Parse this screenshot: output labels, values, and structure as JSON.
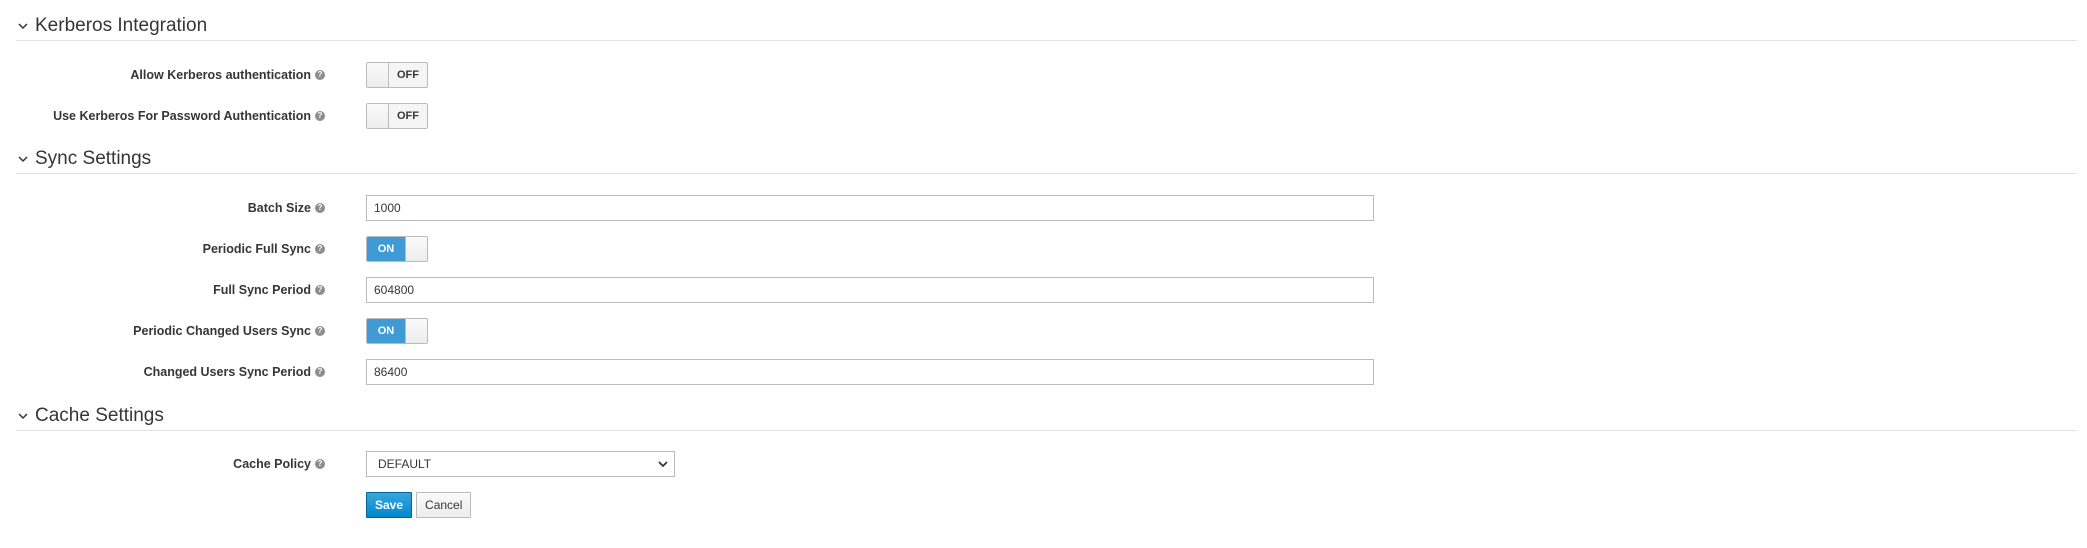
{
  "sections": {
    "kerberos": {
      "title": "Kerberos Integration",
      "fields": {
        "allow_kerberos_auth": {
          "label": "Allow Kerberos authentication",
          "state": "OFF"
        },
        "use_kerberos_password": {
          "label": "Use Kerberos For Password Authentication",
          "state": "OFF"
        }
      }
    },
    "sync": {
      "title": "Sync Settings",
      "fields": {
        "batch_size": {
          "label": "Batch Size",
          "value": "1000"
        },
        "periodic_full_sync": {
          "label": "Periodic Full Sync",
          "state": "ON"
        },
        "full_sync_period": {
          "label": "Full Sync Period",
          "value": "604800"
        },
        "periodic_changed_users_sync": {
          "label": "Periodic Changed Users Sync",
          "state": "ON"
        },
        "changed_users_sync_period": {
          "label": "Changed Users Sync Period",
          "value": "86400"
        }
      }
    },
    "cache": {
      "title": "Cache Settings",
      "fields": {
        "cache_policy": {
          "label": "Cache Policy",
          "selected": "DEFAULT"
        }
      }
    }
  },
  "actions": {
    "save_label": "Save",
    "cancel_label": "Cancel"
  },
  "icons": {
    "section_toggle": "chevron-down-icon",
    "help": "question-circle-icon",
    "select_caret": "chevron-down-icon"
  },
  "colors": {
    "switch_on": "#3f9ad6",
    "primary_button": "#0088ce",
    "text": "#363636"
  }
}
